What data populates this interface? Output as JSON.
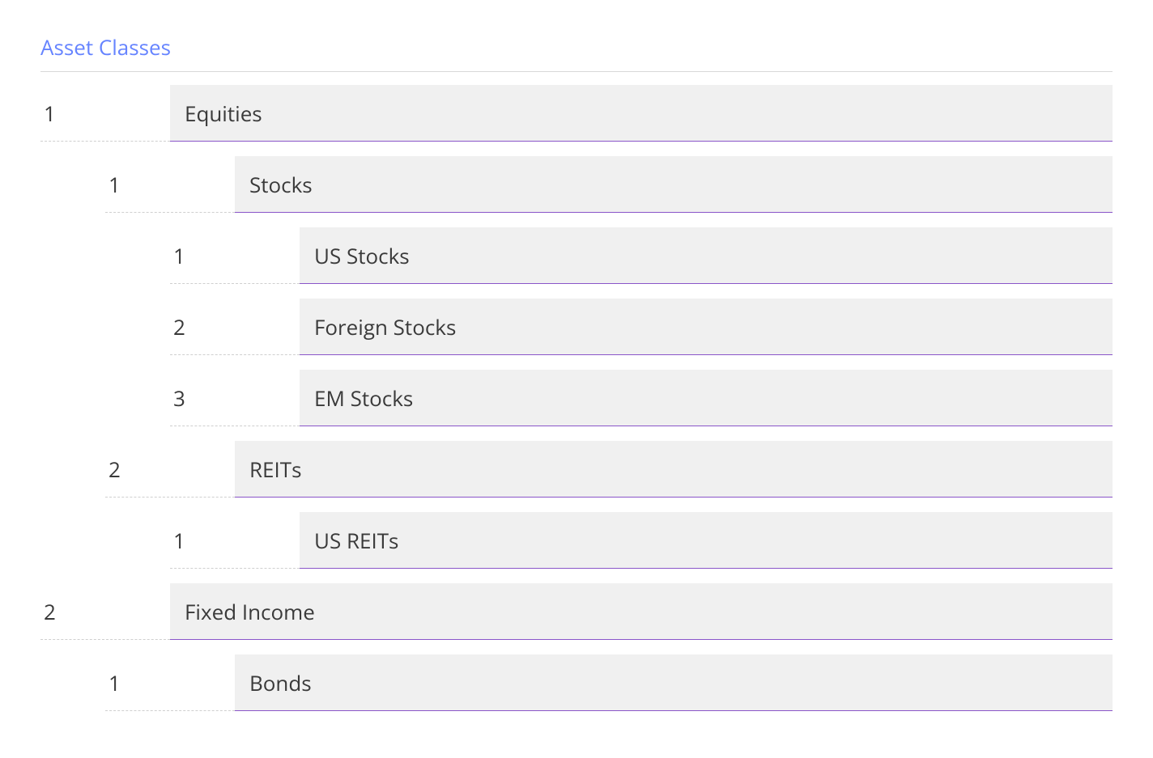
{
  "section_title": "Asset Classes",
  "tree": [
    {
      "num": "1",
      "label": "Equities",
      "children": [
        {
          "num": "1",
          "label": "Stocks",
          "children": [
            {
              "num": "1",
              "label": "US Stocks",
              "children": []
            },
            {
              "num": "2",
              "label": "Foreign Stocks",
              "children": []
            },
            {
              "num": "3",
              "label": "EM Stocks",
              "children": []
            }
          ]
        },
        {
          "num": "2",
          "label": "REITs",
          "children": [
            {
              "num": "1",
              "label": "US REITs",
              "children": []
            }
          ]
        }
      ]
    },
    {
      "num": "2",
      "label": "Fixed Income",
      "children": [
        {
          "num": "1",
          "label": "Bonds",
          "children": []
        }
      ]
    }
  ]
}
